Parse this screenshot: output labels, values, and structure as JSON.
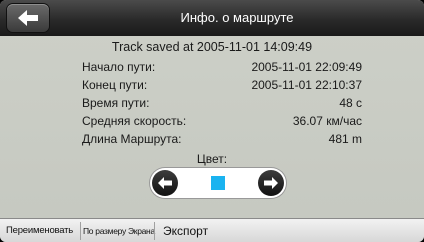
{
  "header": {
    "title": "Инфо. о маршруте",
    "back_icon": "arrow-left-icon"
  },
  "info": {
    "saved_text": "Track saved at 2005-11-01 14:09:49",
    "rows": [
      {
        "label": "Начало пути:",
        "value": "2005-11-01 22:09:49"
      },
      {
        "label": "Конец пути:",
        "value": "2005-11-01 22:10:37"
      },
      {
        "label": "Время пути:",
        "value": "48 с"
      },
      {
        "label": "Средняя скорость:",
        "value": "36.07 км/час"
      },
      {
        "label": "Длина Маршрута:",
        "value": "481 m"
      }
    ]
  },
  "color": {
    "label": "Цвет:",
    "selected_hex": "#1ab3f0",
    "prev_icon": "arrow-left-icon",
    "next_icon": "arrow-right-icon"
  },
  "toolbar": {
    "rename_label": "Переименовать",
    "fit_screen_label": "По размеру Экрана",
    "export_label": "Экспорт"
  }
}
